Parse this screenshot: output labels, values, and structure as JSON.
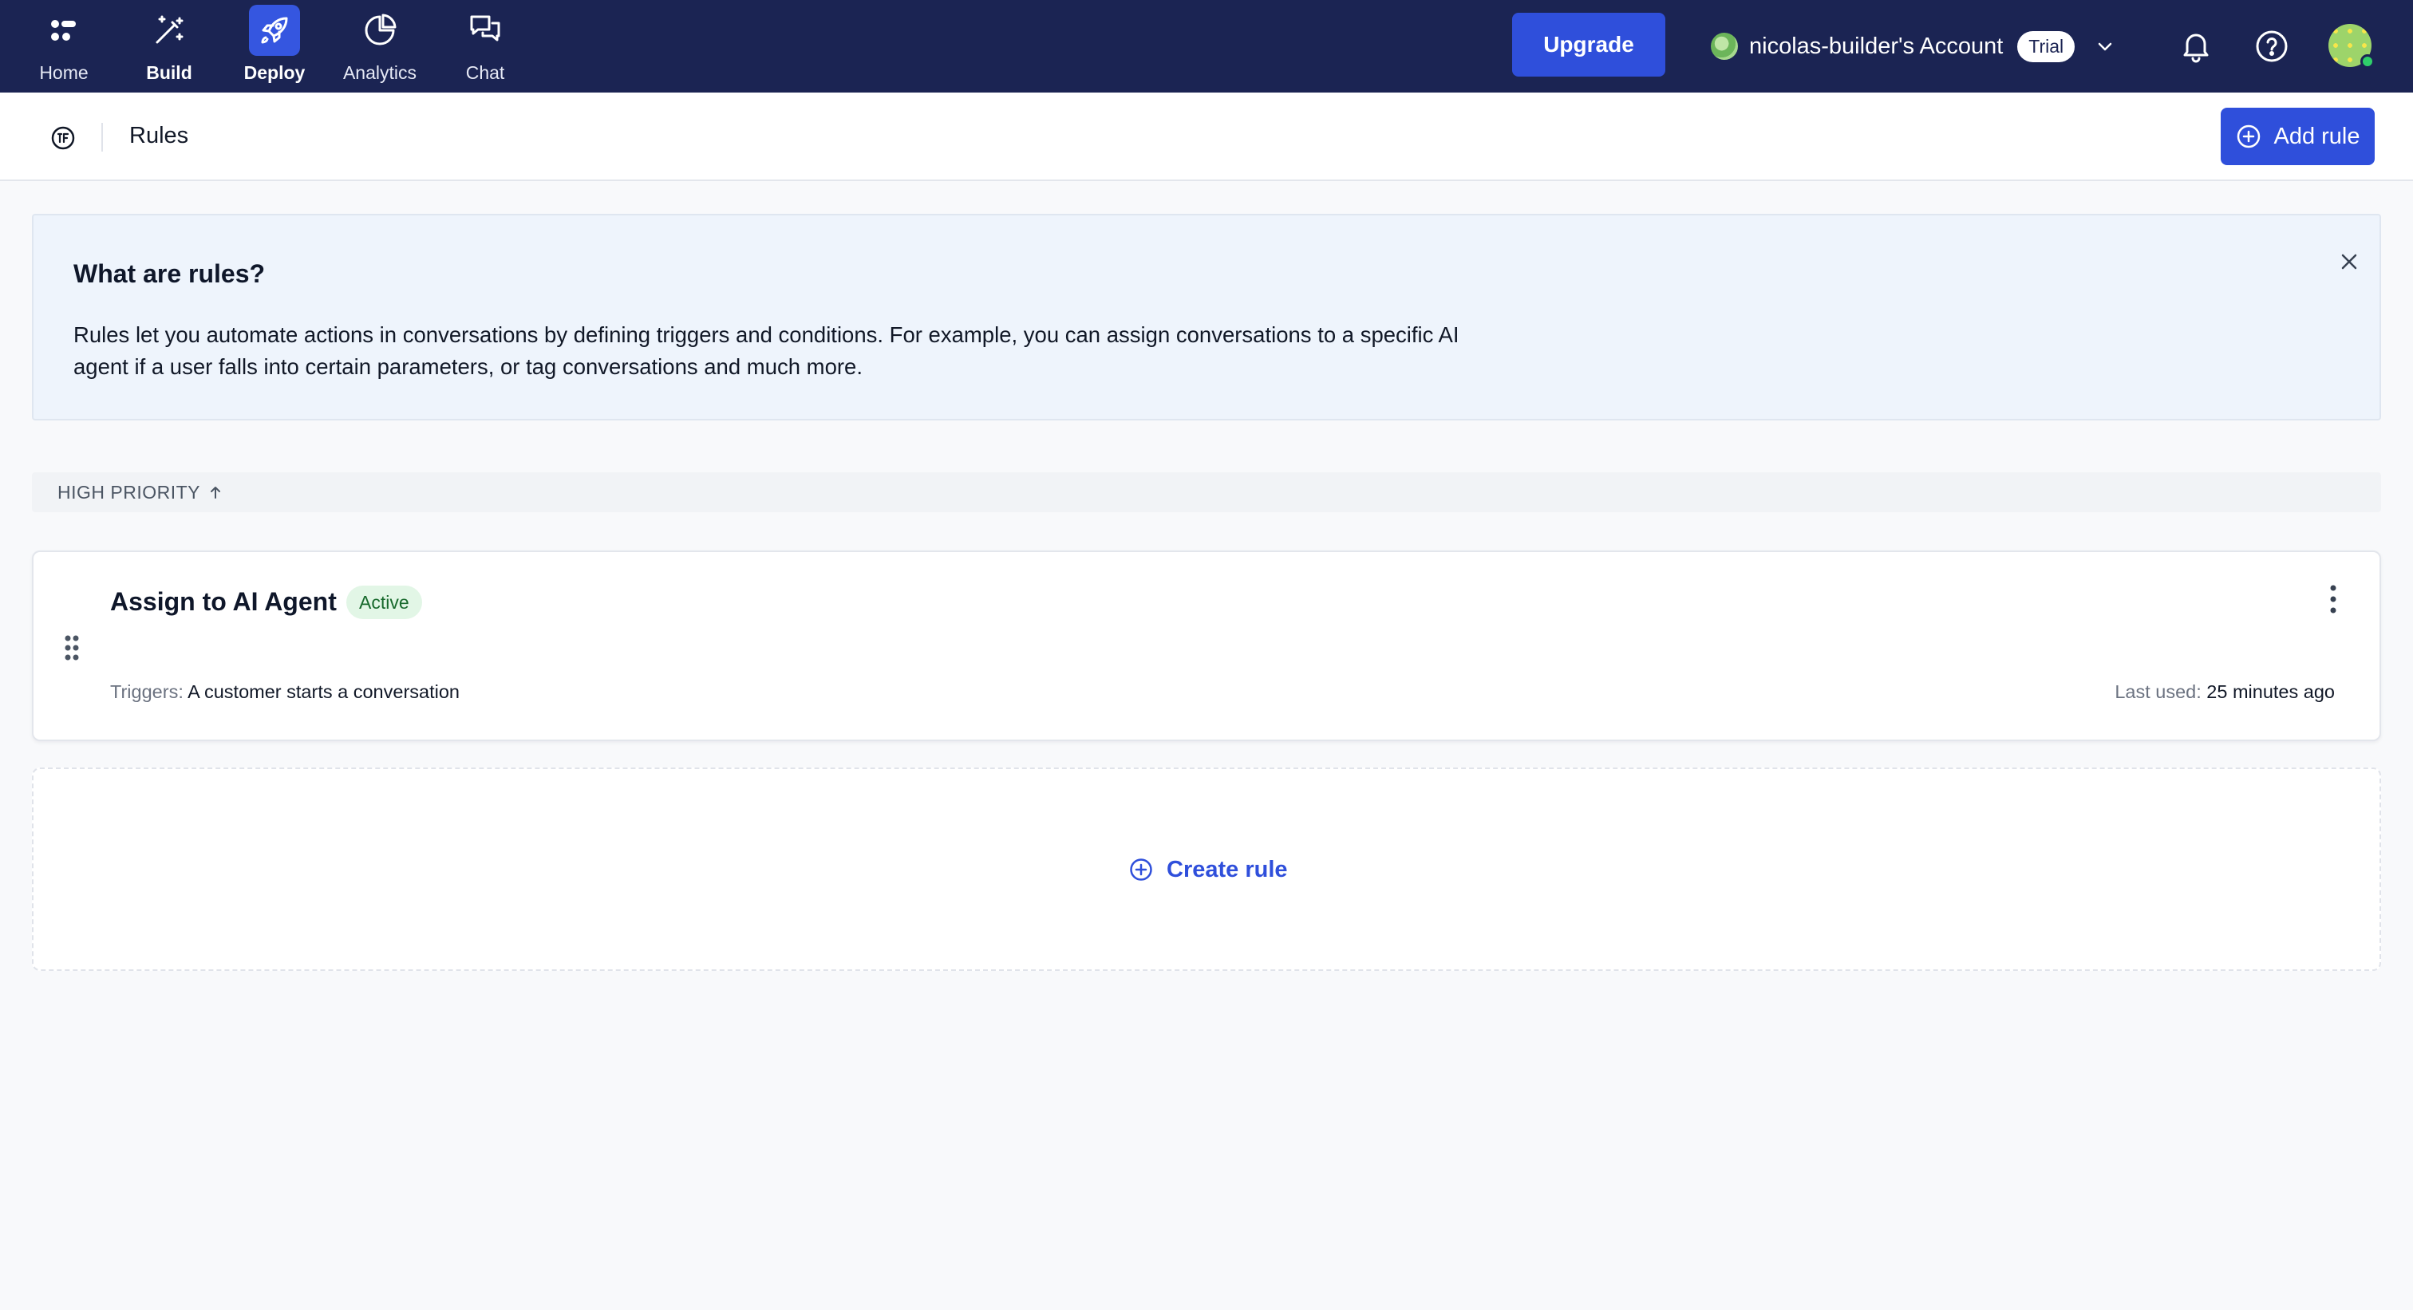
{
  "nav": {
    "items": [
      {
        "label": "Home",
        "icon": "home-icon"
      },
      {
        "label": "Build",
        "icon": "magic-wand-icon"
      },
      {
        "label": "Deploy",
        "icon": "rocket-icon",
        "active": true
      },
      {
        "label": "Analytics",
        "icon": "pie-chart-icon"
      },
      {
        "label": "Chat",
        "icon": "chat-bubbles-icon"
      }
    ],
    "upgrade_label": "Upgrade",
    "account_name": "nicolas-builder's Account",
    "account_badge": "Trial"
  },
  "header": {
    "title": "Rules",
    "add_rule_label": "Add rule"
  },
  "info": {
    "title": "What are rules?",
    "body": "Rules let you automate actions in conversations by defining triggers and conditions. For example, you can assign conversations to a specific AI agent if a user falls into certain parameters, or tag conversations and much more."
  },
  "priority": {
    "label": "HIGH PRIORITY"
  },
  "rules": [
    {
      "name": "Assign to AI Agent",
      "status": "Active",
      "triggers_label": "Triggers:",
      "triggers_value": "A customer starts a conversation",
      "last_used_label": "Last used:",
      "last_used_value": "25 minutes ago"
    }
  ],
  "create": {
    "label": "Create rule"
  },
  "colors": {
    "nav_bg": "#1b2453",
    "accent": "#2f4fdb",
    "info_bg": "#eef4fc",
    "badge_bg": "#e2f6e6",
    "badge_text": "#17692c"
  }
}
